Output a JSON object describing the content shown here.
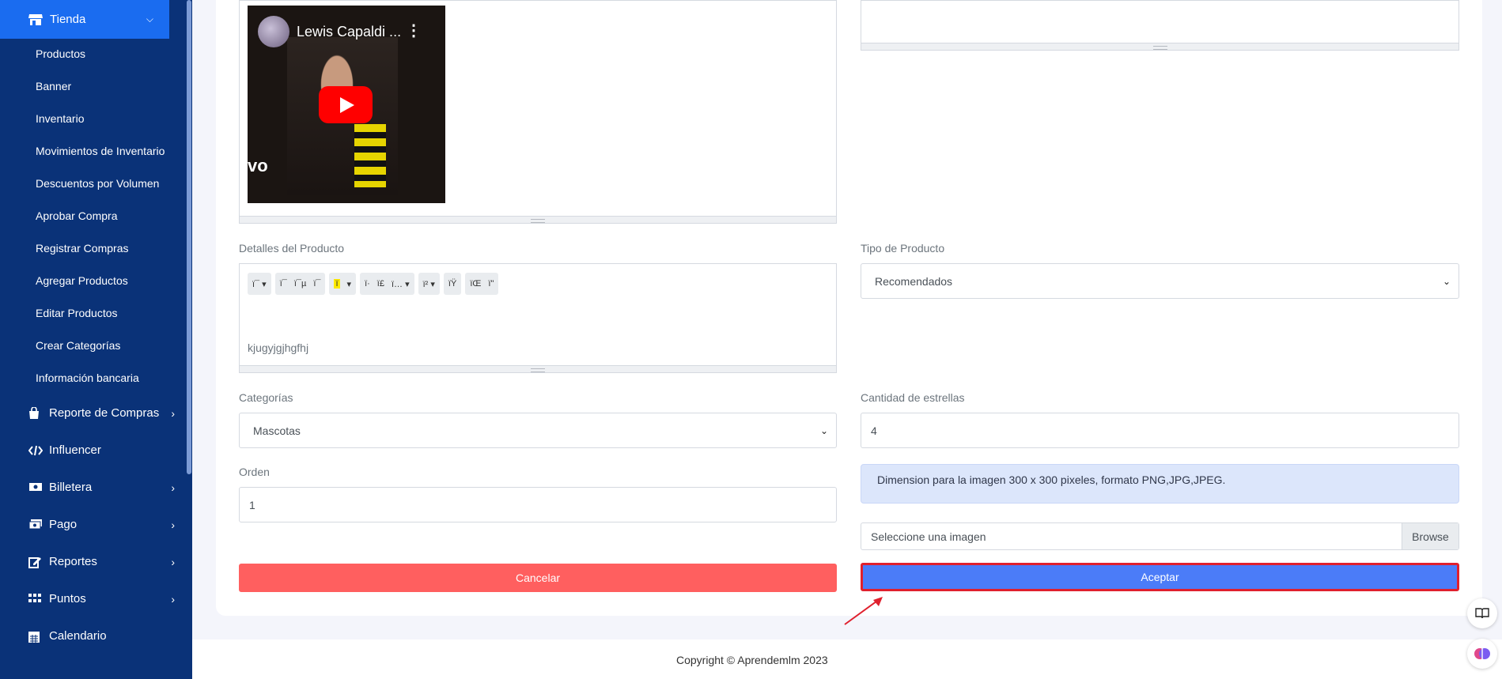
{
  "sidebar": {
    "active": {
      "label": "Tienda",
      "icon": "store-icon"
    },
    "sub_items": [
      "Productos",
      "Banner",
      "Inventario",
      "Movimientos de Inventario",
      "Descuentos por Volumen",
      "Aprobar Compra",
      "Registrar Compras",
      "Agregar Productos",
      "Editar Productos",
      "Crear Categorías",
      "Información bancaria"
    ],
    "main_items": [
      {
        "label": "Reporte de Compras",
        "icon": "shopping-bag-icon",
        "has_arrow": true
      },
      {
        "label": "Influencer",
        "icon": "code-icon",
        "has_arrow": false
      },
      {
        "label": "Billetera",
        "icon": "money-bill-icon",
        "has_arrow": true
      },
      {
        "label": "Pago",
        "icon": "money-check-icon",
        "has_arrow": true
      },
      {
        "label": "Reportes",
        "icon": "edit-icon",
        "has_arrow": true
      },
      {
        "label": "Puntos",
        "icon": "grid-icon",
        "has_arrow": true
      },
      {
        "label": "Calendario",
        "icon": "calendar-icon",
        "has_arrow": false
      }
    ]
  },
  "video": {
    "title": "Lewis Capaldi ...",
    "watermark": "vo"
  },
  "form": {
    "details_label": "Detalles del Producto",
    "details_text": "kjugyjgjhgfhj",
    "toolbar_groups": [
      [
        "ï¯ ▾"
      ],
      [
        "ï¯",
        "ï¯µ",
        "ï¯"
      ],
      [
        "ï",
        "▾"
      ],
      [
        "ï·",
        "ï£",
        "ï… ▾"
      ],
      [
        "ï² ▾"
      ],
      [
        "ïŸ"
      ],
      [
        "ïŒ",
        "ï\""
      ]
    ],
    "type_label": "Tipo de Producto",
    "type_value": "Recomendados",
    "categories_label": "Categorías",
    "categories_value": "Mascotas",
    "stars_label": "Cantidad de estrellas",
    "stars_value": "4",
    "order_label": "Orden",
    "order_value": "1",
    "image_info": "Dimension para la imagen 300 x 300 pixeles, formato PNG,JPG,JPEG.",
    "file_placeholder": "Seleccione una imagen",
    "browse_label": "Browse",
    "cancel_label": "Cancelar",
    "accept_label": "Aceptar"
  },
  "footer": {
    "copyright": "Copyright © Aprendemlm 2023"
  },
  "colors": {
    "sidebar_bg": "#0a3278",
    "active_bg": "#1a6cf0",
    "cancel_bg": "#ff5f5f",
    "accept_bg": "#4b7cf8",
    "annotation_red": "#e0202d"
  }
}
